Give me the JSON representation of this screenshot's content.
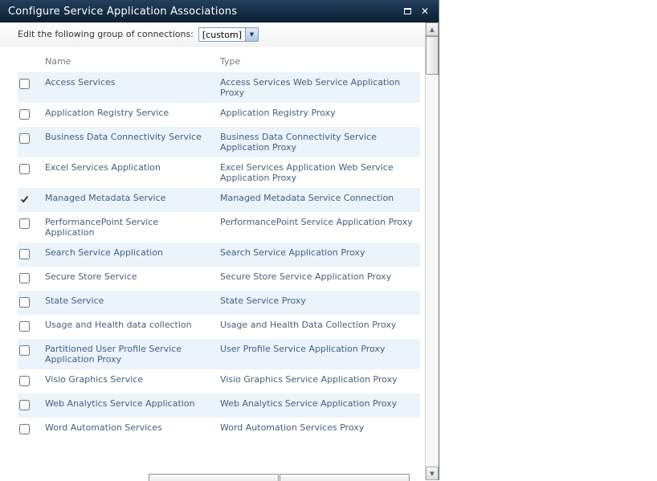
{
  "dialog": {
    "title": "Configure Service Application Associations"
  },
  "edit_strip": {
    "label": "Edit the following group of connections:",
    "dropdown_value": "[custom]"
  },
  "table": {
    "columns": {
      "name": "Name",
      "type": "Type"
    },
    "rows": [
      {
        "name": "Access Services",
        "type": "Access Services Web Service Application Proxy",
        "checked": false
      },
      {
        "name": "Application Registry Service",
        "type": "Application Registry Proxy",
        "checked": false
      },
      {
        "name": "Business Data Connectivity Service",
        "type": "Business Data Connectivity Service Application Proxy",
        "checked": false
      },
      {
        "name": "Excel Services Application",
        "type": "Excel Services Application Web Service Application Proxy",
        "checked": false
      },
      {
        "name": "Managed Metadata Service",
        "type": "Managed Metadata Service Connection",
        "checked": true
      },
      {
        "name": "PerformancePoint Service Application",
        "type": "PerformancePoint Service Application Proxy",
        "checked": false
      },
      {
        "name": "Search Service Application",
        "type": "Search Service Application Proxy",
        "checked": false
      },
      {
        "name": "Secure Store Service",
        "type": "Secure Store Service Application Proxy",
        "checked": false
      },
      {
        "name": "State Service",
        "type": "State Service Proxy",
        "checked": false
      },
      {
        "name": "Usage and Health data collection",
        "type": "Usage and Health Data Collection Proxy",
        "checked": false
      },
      {
        "name": "Partitioned User Profile Service Application Proxy",
        "type": "User Profile Service Application Proxy",
        "checked": false
      },
      {
        "name": "Visio Graphics Service",
        "type": "Visio Graphics Service Application Proxy",
        "checked": false
      },
      {
        "name": "Web Analytics Service Application",
        "type": "Web Analytics Service Application Proxy",
        "checked": false
      },
      {
        "name": "Word Automation Services",
        "type": "Word Automation Services Proxy",
        "checked": false
      }
    ]
  },
  "icons": {
    "dropdown_arrow": "▼",
    "scroll_up": "▲",
    "scroll_down": "▼"
  },
  "colors": {
    "titlebar": "#152c44",
    "row_alt": "#ebf3fb",
    "row_text": "#44617d"
  }
}
